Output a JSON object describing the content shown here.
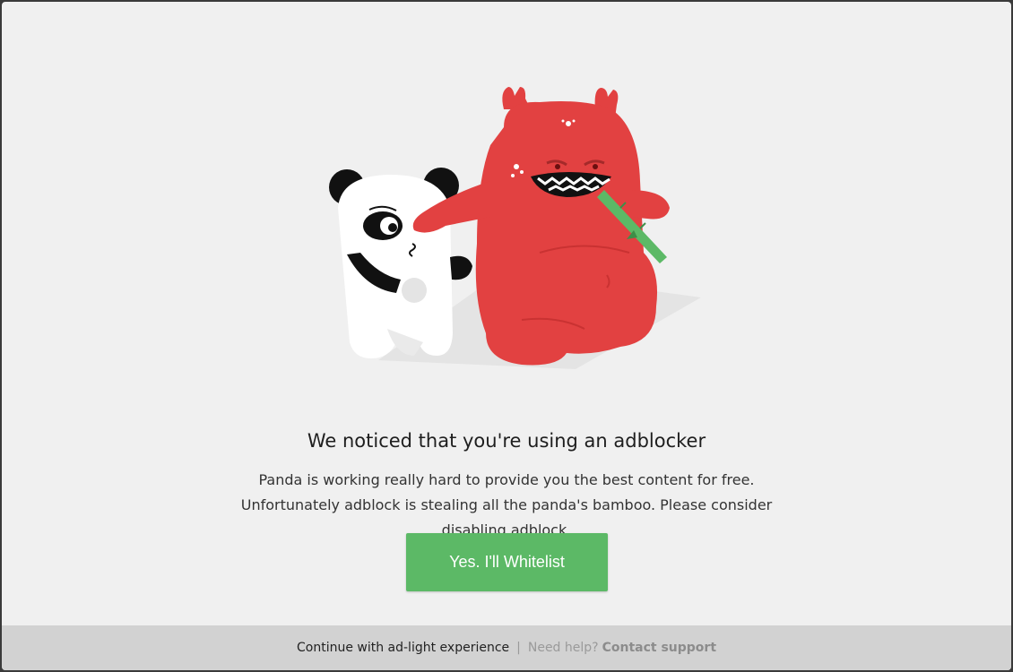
{
  "dialog": {
    "title": "We noticed that you're using an adblocker",
    "message": "Panda is working really hard to provide you the best content for free. Unfortunately adblock is stealing all the panda's bamboo. Please consider disabling adblock.",
    "whitelist_button": "Yes. I'll Whitelist"
  },
  "footer": {
    "continue_link": "Continue with ad-light experience",
    "separator": "|",
    "help_text": "Need help?",
    "contact_link": "Contact support"
  },
  "colors": {
    "modal_bg": "#f0f0f0",
    "button_green": "#5cb966",
    "monster_red": "#e24141",
    "footer_bg": "#d2d2d2"
  },
  "illustration": {
    "characters": [
      "panda",
      "red-monster",
      "bamboo"
    ]
  }
}
